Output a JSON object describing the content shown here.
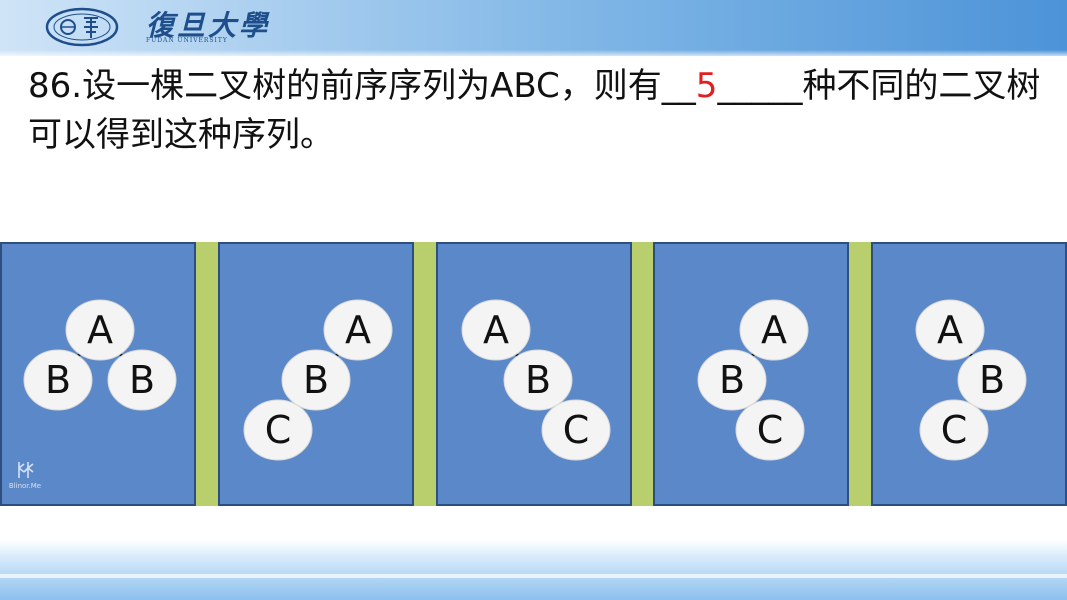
{
  "header": {
    "univ_name_cn": "復旦大學",
    "univ_name_en": "FUDAN UNIVERSITY"
  },
  "question": {
    "prefix": "86.设一棵二叉树的前序序列为ABC，则有__",
    "answer": "5",
    "suffix": "_____种不同的二叉树可以得到这种序列。"
  },
  "diagram": {
    "panels": [
      {
        "nodes": [
          {
            "label": "A",
            "parent": null,
            "side": null
          },
          {
            "label": "B",
            "parent": "A",
            "side": "left"
          },
          {
            "label": "B",
            "parent": "A",
            "side": "right"
          }
        ]
      },
      {
        "nodes": [
          {
            "label": "A",
            "parent": null,
            "side": null
          },
          {
            "label": "B",
            "parent": "A",
            "side": "left"
          },
          {
            "label": "C",
            "parent": "B",
            "side": "left"
          }
        ]
      },
      {
        "nodes": [
          {
            "label": "A",
            "parent": null,
            "side": null
          },
          {
            "label": "B",
            "parent": "A",
            "side": "right"
          },
          {
            "label": "C",
            "parent": "B",
            "side": "right"
          }
        ]
      },
      {
        "nodes": [
          {
            "label": "A",
            "parent": null,
            "side": null
          },
          {
            "label": "B",
            "parent": "A",
            "side": "left"
          },
          {
            "label": "C",
            "parent": "B",
            "side": "right"
          }
        ]
      },
      {
        "nodes": [
          {
            "label": "A",
            "parent": null,
            "side": null
          },
          {
            "label": "B",
            "parent": "A",
            "side": "right"
          },
          {
            "label": "C",
            "parent": "B",
            "side": "left"
          }
        ]
      }
    ],
    "colors": {
      "panel_bg": "#5b88c9",
      "separator": "#b9cf6e",
      "node_fill": "#f4f4f4",
      "edge": "#111111",
      "answer": "#e02020"
    },
    "watermark_text": "Blinor.Me"
  }
}
